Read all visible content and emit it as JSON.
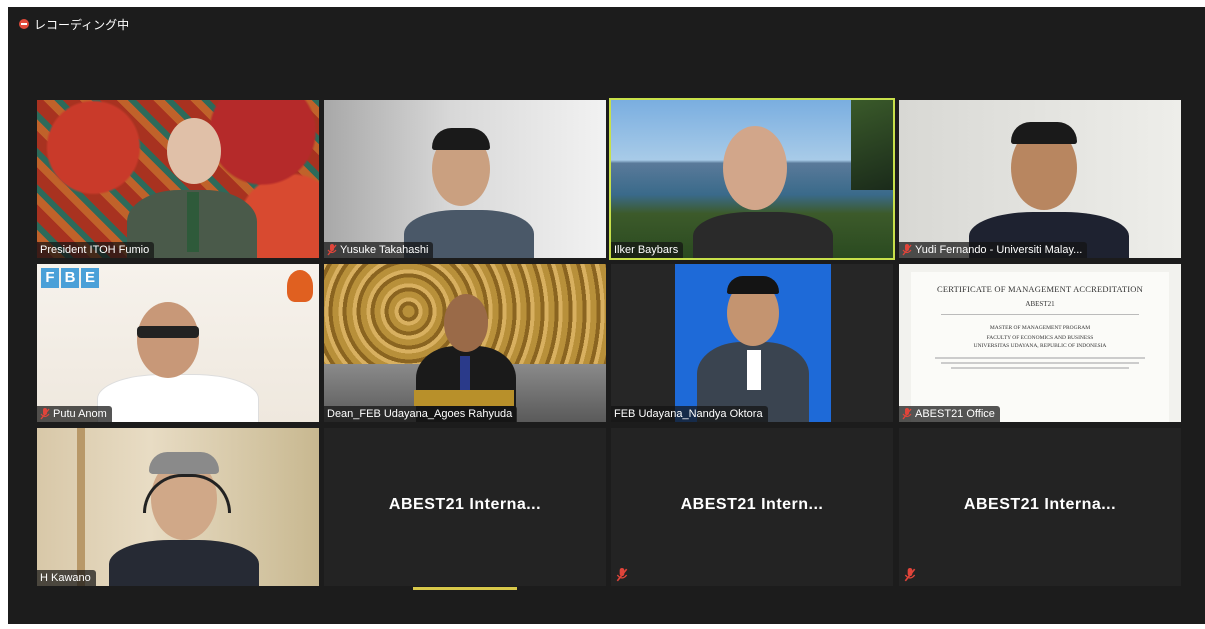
{
  "recording": {
    "label": "レコーディング中"
  },
  "tiles": [
    {
      "name": "President ITOH Fumio",
      "muted": false
    },
    {
      "name": "Yusuke Takahashi",
      "muted": true
    },
    {
      "name": "Ilker Baybars",
      "muted": false,
      "active_speaker": true
    },
    {
      "name": "Yudi Fernando - Universiti Malay...",
      "muted": true
    },
    {
      "name": "Putu Anom",
      "muted": true,
      "logo_text": "FBE"
    },
    {
      "name": "Dean_FEB Udayana_Agoes Rahyuda",
      "muted": false
    },
    {
      "name": "FEB Udayana_Nandya Oktora",
      "muted": false
    },
    {
      "name": "ABEST21 Office",
      "muted": true,
      "certificate": {
        "title": "CERTIFICATE OF MANAGEMENT ACCREDITATION",
        "org": "ABEST21",
        "program": "MASTER OF MANAGEMENT PROGRAM",
        "faculty": "FACULTY OF ECONOMICS AND BUSINESS",
        "university": "UNIVERSITAS UDAYANA, REPUBLIC OF INDONESIA"
      }
    },
    {
      "name": "H Kawano",
      "muted": false
    },
    {
      "name": "ABEST21  Interna...",
      "muted": true,
      "video_off": true
    },
    {
      "name": "ABEST21   Intern...",
      "muted": true,
      "video_off": true
    },
    {
      "name": "ABEST21  Interna...",
      "muted": true,
      "video_off": true
    }
  ],
  "colors": {
    "background": "#1c1c1c",
    "speaker_outline": "#c8e04a",
    "mute_icon": "#e0443a",
    "recording_dot": "#e04a3a"
  }
}
